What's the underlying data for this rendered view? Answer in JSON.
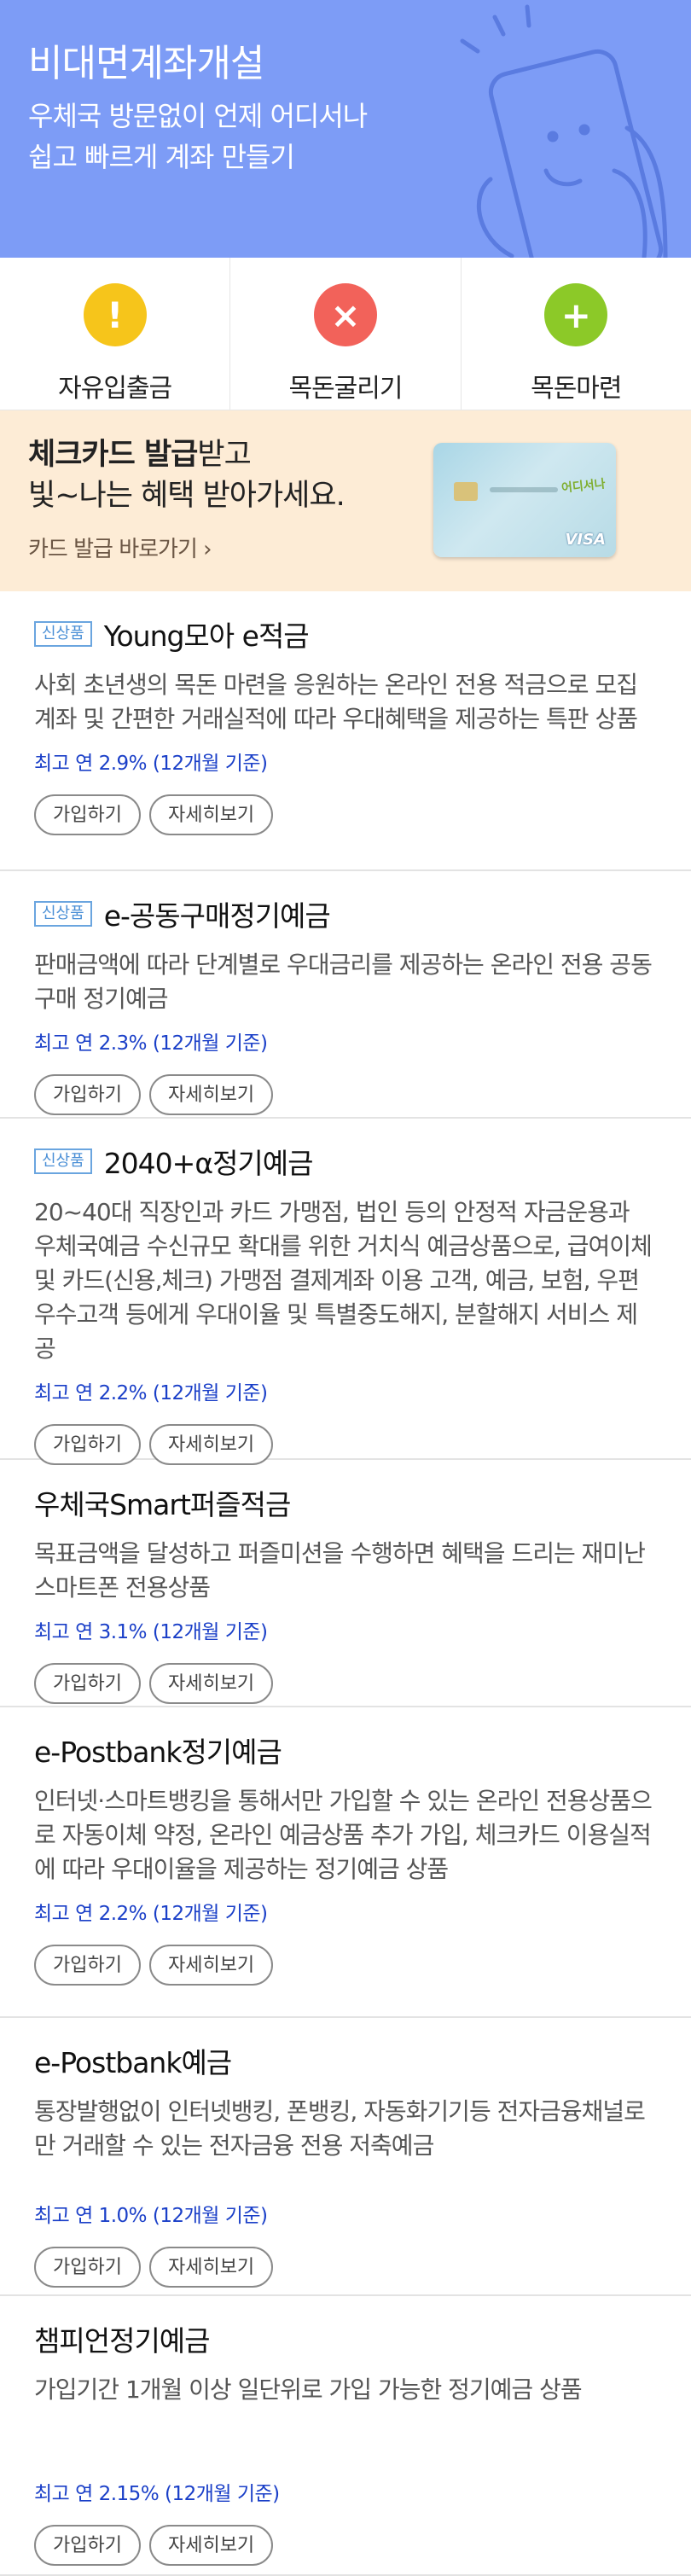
{
  "hero": {
    "title": "비대면계좌개설",
    "subtitle": "우체국 방문없이 언제 어디서나\n쉽고 빠르게 계좌 만들기"
  },
  "quick_menu": [
    {
      "label": "자유입출금",
      "icon": "exclamation-icon",
      "glyph": "!",
      "color": "#f6c51b"
    },
    {
      "label": "목돈굴리기",
      "icon": "close-x-icon",
      "glyph": "×",
      "color": "#f2625a"
    },
    {
      "label": "목돈마련",
      "icon": "plus-icon",
      "glyph": "+",
      "color": "#8cc928"
    }
  ],
  "banner": {
    "title_bold": "체크카드 발급",
    "title_rest": "받고",
    "title_line2": "빛~나는 혜택 받아가세요.",
    "link": "카드 발급 바로가기",
    "card_logo": "어디서나",
    "card_visa": "VISA"
  },
  "products": [
    {
      "badge": "신상품",
      "title": "Young모아 e적금",
      "desc": "사회 초년생의 목돈 마련을 응원하는 온라인 전용 적금으로 모집계좌 및 간편한 거래실적에 따라 우대혜택을 제공하는 특판 상품",
      "rate": "최고 연 2.9% (12개월 기준)",
      "join": "가입하기",
      "detail": "자세히보기"
    },
    {
      "badge": "신상품",
      "title": "e-공동구매정기예금",
      "desc": "판매금액에 따라 단계별로 우대금리를 제공하는 온라인 전용 공동구매 정기예금",
      "rate": "최고 연 2.3% (12개월 기준)",
      "join": "가입하기",
      "detail": "자세히보기"
    },
    {
      "badge": "신상품",
      "title": "2040+α정기예금",
      "desc": "20~40대 직장인과 카드 가맹점, 법인 등의 안정적 자금운용과 우체국예금 수신규모 확대를 위한 거치식 예금상품으로, 급여이체 및 카드(신용,체크) 가맹점 결제계좌 이용 고객, 예금, 보험, 우편 우수고객 등에게 우대이율 및 특별중도해지, 분할해지 서비스 제공",
      "rate": "최고 연 2.2% (12개월 기준)",
      "join": "가입하기",
      "detail": "자세히보기"
    },
    {
      "badge": "",
      "title": "우체국Smart퍼즐적금",
      "desc": "목표금액을 달성하고 퍼즐미션을 수행하면 혜택을 드리는 재미난 스마트폰 전용상품",
      "rate": "최고 연 3.1% (12개월 기준)",
      "join": "가입하기",
      "detail": "자세히보기"
    },
    {
      "badge": "",
      "title": "e-Postbank정기예금",
      "desc": "인터넷·스마트뱅킹을 통해서만 가입할 수 있는 온라인 전용상품으로 자동이체 약정, 온라인 예금상품 추가 가입, 체크카드 이용실적에 따라 우대이율을 제공하는 정기예금 상품",
      "rate": "최고 연 2.2% (12개월 기준)",
      "join": "가입하기",
      "detail": "자세히보기"
    },
    {
      "badge": "",
      "title": "e-Postbank예금",
      "desc": "통장발행없이 인터넷뱅킹, 폰뱅킹, 자동화기기등 전자금융채널로만 거래할 수 있는 전자금융 전용 저축예금",
      "rate": "최고 연 1.0% (12개월 기준)",
      "join": "가입하기",
      "detail": "자세히보기"
    },
    {
      "badge": "",
      "title": "챔피언정기예금",
      "desc": "가입기간 1개월 이상 일단위로 가입 가능한 정기예금 상품",
      "rate": "최고 연 2.15% (12개월 기준)",
      "join": "가입하기",
      "detail": "자세히보기"
    }
  ]
}
